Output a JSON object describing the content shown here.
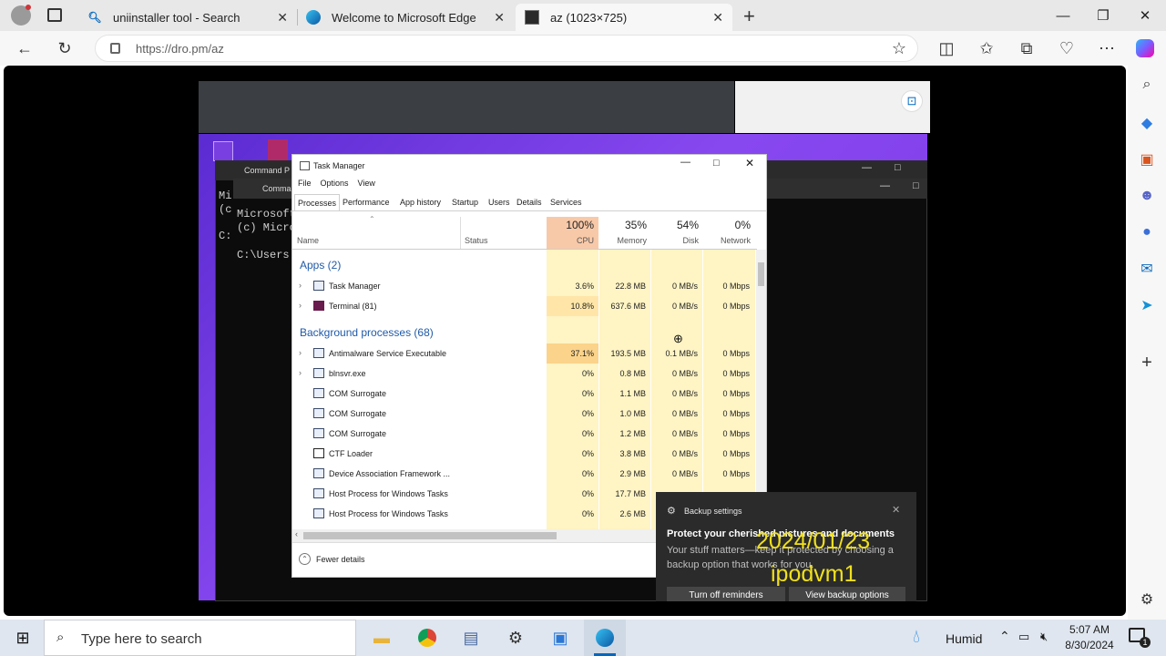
{
  "browser": {
    "tabs": [
      {
        "title": "uniinstaller tool - Search",
        "icon": "search-icon"
      },
      {
        "title": "Welcome to Microsoft Edge",
        "icon": "edge-icon"
      },
      {
        "title": "az (1023×725)",
        "icon": "image-thumbnail-icon"
      }
    ],
    "url": "https://dro.pm/az"
  },
  "command_prompt": {
    "title_1": "Command P",
    "title_2": "Comma",
    "lines": [
      "Mi",
      "(c",
      "Microsoft",
      "(c) Micro",
      "C:",
      "C:\\Users"
    ]
  },
  "task_manager": {
    "title": "Task Manager",
    "menu": [
      "File",
      "Options",
      "View"
    ],
    "tabs": [
      "Processes",
      "Performance",
      "App history",
      "Startup",
      "Users",
      "Details",
      "Services"
    ],
    "columns": {
      "name": "Name",
      "status": "Status",
      "cpu": {
        "pct": "100%",
        "label": "CPU"
      },
      "memory": {
        "pct": "35%",
        "label": "Memory"
      },
      "disk": {
        "pct": "54%",
        "label": "Disk"
      },
      "network": {
        "pct": "0%",
        "label": "Network"
      }
    },
    "groups": {
      "apps": "Apps (2)",
      "background": "Background processes (68)"
    },
    "apps": [
      {
        "name": "Task Manager",
        "cpu": "3.6%",
        "memory": "22.8 MB",
        "disk": "0 MB/s",
        "network": "0 Mbps"
      },
      {
        "name": "Terminal (81)",
        "cpu": "10.8%",
        "memory": "637.6 MB",
        "disk": "0 MB/s",
        "network": "0 Mbps"
      }
    ],
    "background": [
      {
        "name": "Antimalware Service Executable",
        "cpu": "37.1%",
        "memory": "193.5 MB",
        "disk": "0.1 MB/s",
        "network": "0 Mbps"
      },
      {
        "name": "blnsvr.exe",
        "cpu": "0%",
        "memory": "0.8 MB",
        "disk": "0 MB/s",
        "network": "0 Mbps"
      },
      {
        "name": "COM Surrogate",
        "cpu": "0%",
        "memory": "1.1 MB",
        "disk": "0 MB/s",
        "network": "0 Mbps"
      },
      {
        "name": "COM Surrogate",
        "cpu": "0%",
        "memory": "1.0 MB",
        "disk": "0 MB/s",
        "network": "0 Mbps"
      },
      {
        "name": "COM Surrogate",
        "cpu": "0%",
        "memory": "1.2 MB",
        "disk": "0 MB/s",
        "network": "0 Mbps"
      },
      {
        "name": "CTF Loader",
        "cpu": "0%",
        "memory": "3.8 MB",
        "disk": "0 MB/s",
        "network": "0 Mbps"
      },
      {
        "name": "Device Association Framework ...",
        "cpu": "0%",
        "memory": "2.9 MB",
        "disk": "0 MB/s",
        "network": "0 Mbps"
      },
      {
        "name": "Host Process for Windows Tasks",
        "cpu": "0%",
        "memory": "17.7 MB",
        "disk": "",
        "network": ""
      },
      {
        "name": "Host Process for Windows Tasks",
        "cpu": "0%",
        "memory": "2.6 MB",
        "disk": "",
        "network": ""
      }
    ],
    "footer": "Fewer details"
  },
  "toast": {
    "app": "Backup settings",
    "heading": "Protect your cherished pictures and documents",
    "body": "Your stuff matters—keep it protected by choosing a backup option that works for you.",
    "btn_off": "Turn off reminders",
    "btn_view": "View backup options",
    "watermark_date": "2024/01/23",
    "watermark_host": "ipodvm1"
  },
  "taskbar": {
    "search_placeholder": "Type here to search",
    "weather": "Humid",
    "time": "5:07 AM",
    "date": "8/30/2024",
    "notif_count": "1"
  },
  "colors": {
    "cpu_hot": "#f8c9a8",
    "cpu_col": "#fff4c4",
    "accent": "#0067c0"
  }
}
